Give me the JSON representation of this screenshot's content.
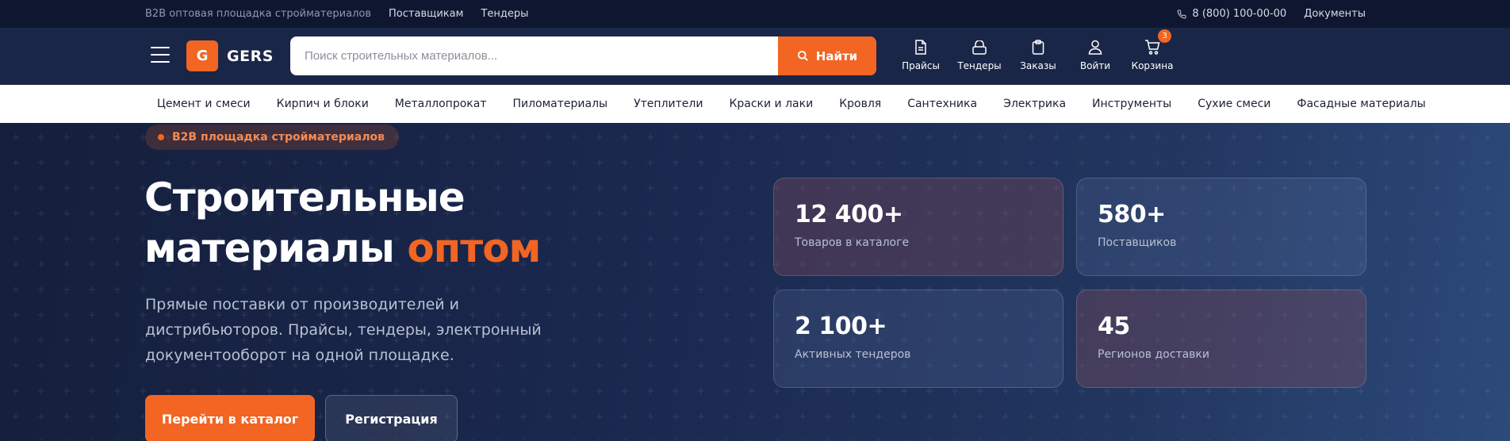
{
  "topbar": {
    "tagline": "B2B оптовая площадка стройматериалов",
    "links": [
      "Поставщикам",
      "Тендеры"
    ],
    "phone": "8 (800) 100-00-00",
    "documents": "Документы"
  },
  "header": {
    "logo_letter": "G",
    "logo_text": "GERS",
    "search_placeholder": "Поиск строительных материалов...",
    "search_button": "Найти",
    "actions": [
      {
        "label": "Прайсы",
        "icon": "price-list-icon"
      },
      {
        "label": "Тендеры",
        "icon": "tender-icon"
      },
      {
        "label": "Заказы",
        "icon": "orders-icon"
      },
      {
        "label": "Войти",
        "icon": "user-icon"
      },
      {
        "label": "Корзина",
        "icon": "cart-icon",
        "badge": "3"
      }
    ]
  },
  "categories": [
    "Цемент и смеси",
    "Кирпич и блоки",
    "Металлопрокат",
    "Пиломатериалы",
    "Утеплители",
    "Краски и лаки",
    "Кровля",
    "Сантехника",
    "Электрика",
    "Инструменты",
    "Сухие смеси",
    "Фасадные материалы"
  ],
  "hero": {
    "pill": "B2B площадка стройматериалов",
    "title_line1": "Строительные",
    "title_line2": "материалы",
    "title_accent": "оптом",
    "subtitle": "Прямые поставки от производителей и дистрибьюторов. Прайсы, тендеры, электронный документооборот на одной площадке.",
    "primary_button": "Перейти в каталог",
    "secondary_button": "Регистрация"
  },
  "stats": [
    {
      "value": "12 400+",
      "caption": "Товаров в каталоге"
    },
    {
      "value": "580+",
      "caption": "Поставщиков"
    },
    {
      "value": "2 100+",
      "caption": "Активных тендеров"
    },
    {
      "value": "45",
      "caption": "Регионов доставки"
    }
  ],
  "colors": {
    "accent": "#f26522",
    "topbar": "#0f1730",
    "header": "#1a2647",
    "hero_dark": "#151f3c"
  }
}
